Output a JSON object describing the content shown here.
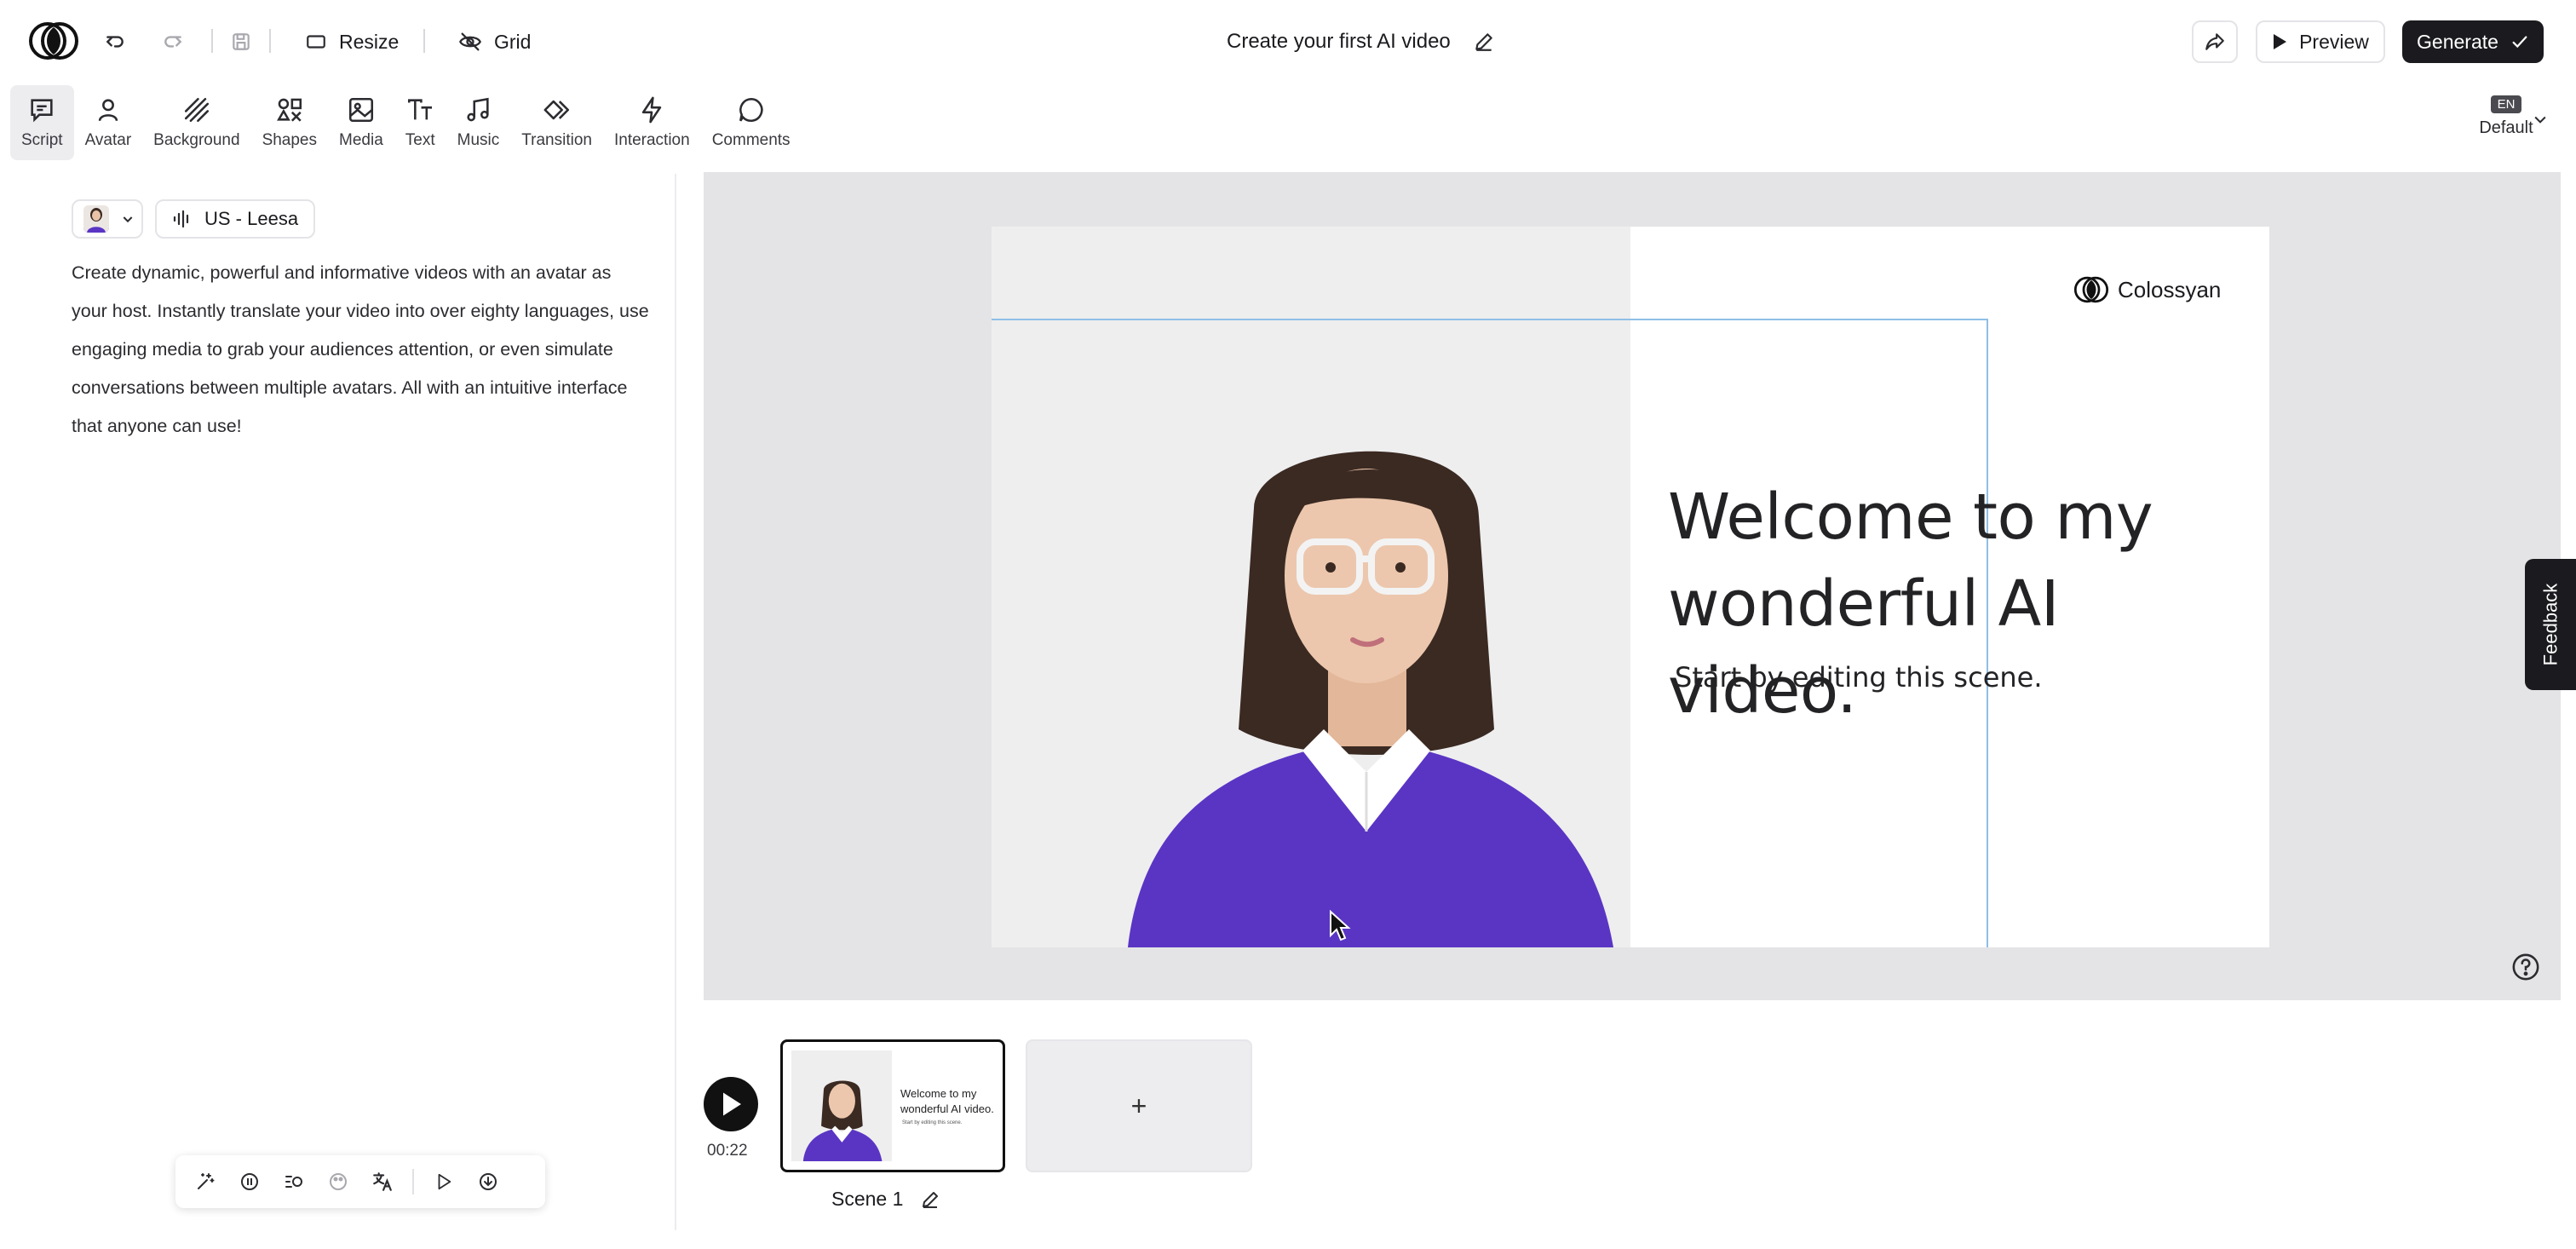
{
  "topbar": {
    "resize_label": "Resize",
    "grid_label": "Grid",
    "project_title": "Create your first AI video",
    "preview_label": "Preview",
    "generate_label": "Generate"
  },
  "tools": [
    {
      "label": "Script",
      "icon": "message-icon",
      "active": true
    },
    {
      "label": "Avatar",
      "icon": "person-icon"
    },
    {
      "label": "Background",
      "icon": "stripes-icon"
    },
    {
      "label": "Shapes",
      "icon": "shapes-icon"
    },
    {
      "label": "Media",
      "icon": "image-icon"
    },
    {
      "label": "Text",
      "icon": "text-icon"
    },
    {
      "label": "Music",
      "icon": "music-note-icon"
    },
    {
      "label": "Transition",
      "icon": "transition-icon"
    },
    {
      "label": "Interaction",
      "icon": "lightning-icon"
    },
    {
      "label": "Comments",
      "icon": "comment-bubble-icon"
    }
  ],
  "language": {
    "code": "EN",
    "label": "Default"
  },
  "script": {
    "voice_label": "US - Leesa",
    "text": "Create dynamic, powerful and informative videos with an avatar as your host. Instantly translate your video into over eighty languages, use engaging media to grab your audiences attention, or even simulate conversations between multiple avatars. All with an intuitive interface that anyone can use!"
  },
  "slide": {
    "brand": "Colossyan",
    "title_line1": "Welcome to my",
    "title_line2": "wonderful AI video.",
    "subtitle": "Start by editing this scene."
  },
  "feedback_label": "Feedback",
  "timeline": {
    "duration": "00:22",
    "scene_label": "Scene 1",
    "thumb_title": "Welcome to my wonderful AI video.",
    "thumb_sub": "Start by editing this scene.",
    "add_label": "+"
  },
  "colors": {
    "accent": "#1b1b1f",
    "selection": "#8fbfe6",
    "avatar_sweater": "#5a35c4"
  }
}
